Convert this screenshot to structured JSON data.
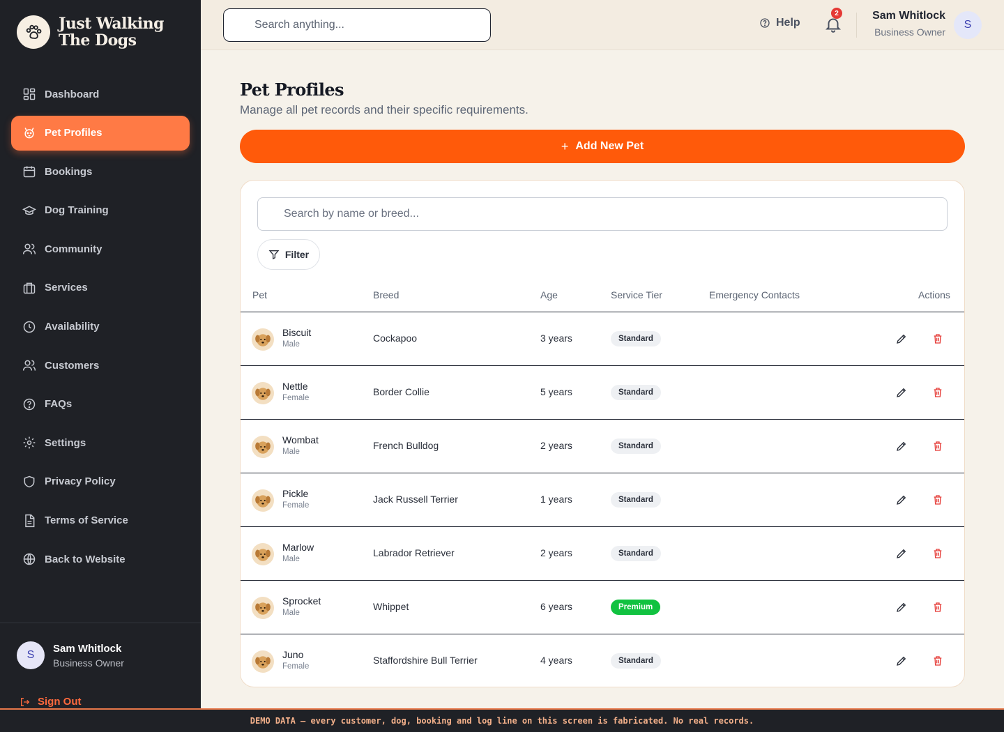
{
  "brand": {
    "line1": "Just Walking",
    "line2": "The Dogs"
  },
  "sidebar": {
    "items": [
      {
        "label": "Dashboard",
        "icon": "dashboard-icon"
      },
      {
        "label": "Pet Profiles",
        "icon": "paw-icon",
        "active": true
      },
      {
        "label": "Bookings",
        "icon": "calendar-icon"
      },
      {
        "label": "Dog Training",
        "icon": "graduation-cap-icon"
      },
      {
        "label": "Community",
        "icon": "users-icon"
      },
      {
        "label": "Services",
        "icon": "briefcase-icon"
      },
      {
        "label": "Availability",
        "icon": "clock-icon"
      },
      {
        "label": "Customers",
        "icon": "users-icon"
      },
      {
        "label": "FAQs",
        "icon": "help-circle-icon"
      },
      {
        "label": "Settings",
        "icon": "gear-icon"
      },
      {
        "label": "Privacy Policy",
        "icon": "shield-icon"
      },
      {
        "label": "Terms of Service",
        "icon": "document-icon"
      },
      {
        "label": "Back to Website",
        "icon": "globe-icon"
      }
    ],
    "user": {
      "initial": "S",
      "name": "Sam Whitlock",
      "role": "Business Owner"
    },
    "signout_label": "Sign Out"
  },
  "header": {
    "search_placeholder": "Search anything...",
    "help_label": "Help",
    "notification_count": "2",
    "user": {
      "name": "Sam Whitlock",
      "role": "Business Owner",
      "initial": "S"
    }
  },
  "main": {
    "title": "Pet Profiles",
    "subtitle": "Manage all pet records and their specific requirements.",
    "add_button_label": "Add New Pet",
    "search_placeholder": "Search by name or breed...",
    "filter_label": "Filter",
    "columns": [
      "Pet",
      "Breed",
      "Age",
      "Service Tier",
      "Emergency Contacts",
      "Actions"
    ],
    "rows": [
      {
        "name": "Biscuit",
        "gender": "Male",
        "breed": "Cockapoo",
        "age": "3 years",
        "tier": "Standard",
        "emergency": ""
      },
      {
        "name": "Nettle",
        "gender": "Female",
        "breed": "Border Collie",
        "age": "5 years",
        "tier": "Standard",
        "emergency": ""
      },
      {
        "name": "Wombat",
        "gender": "Male",
        "breed": "French Bulldog",
        "age": "2 years",
        "tier": "Standard",
        "emergency": ""
      },
      {
        "name": "Pickle",
        "gender": "Female",
        "breed": "Jack Russell Terrier",
        "age": "1 years",
        "tier": "Standard",
        "emergency": ""
      },
      {
        "name": "Marlow",
        "gender": "Male",
        "breed": "Labrador Retriever",
        "age": "2 years",
        "tier": "Standard",
        "emergency": ""
      },
      {
        "name": "Sprocket",
        "gender": "Male",
        "breed": "Whippet",
        "age": "6 years",
        "tier": "Premium",
        "emergency": ""
      },
      {
        "name": "Juno",
        "gender": "Female",
        "breed": "Staffordshire Bull Terrier",
        "age": "4 years",
        "tier": "Standard",
        "emergency": ""
      }
    ]
  },
  "footer_notice": "DEMO DATA — every customer, dog, booking and log line on this screen is fabricated. No real records.",
  "colors": {
    "accent": "#ff5a0a",
    "active_nav": "#ff7a45",
    "sidebar_bg": "#1f2126",
    "premium": "#11c240",
    "delete": "#e53935"
  }
}
